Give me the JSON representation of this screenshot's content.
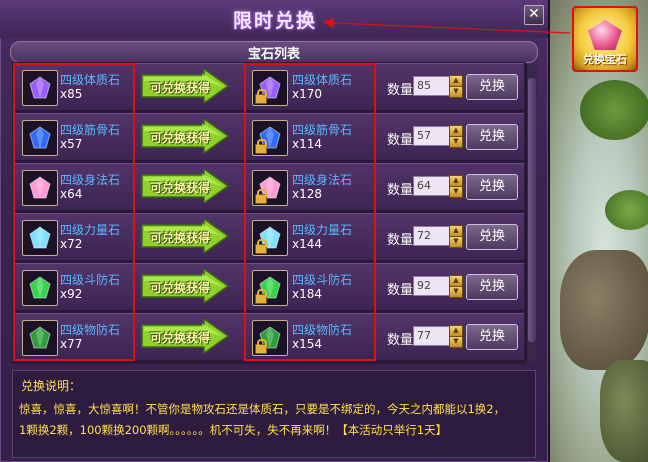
{
  "window": {
    "title": "限时兑换",
    "close_label": "✕",
    "list_header": "宝石列表"
  },
  "gem_shortcut": {
    "label": "兑换宝石"
  },
  "columns": {
    "arrow_label": "可兑换获得",
    "qty_label": "数量",
    "exchange_label": "兑换"
  },
  "rows": [
    {
      "source_name": "四级体质石",
      "source_qty": "x85",
      "target_name": "四级体质石",
      "target_qty": "x170",
      "input_value": "85",
      "gem_color": "#9b5cff"
    },
    {
      "source_name": "四级筋骨石",
      "source_qty": "x57",
      "target_name": "四级筋骨石",
      "target_qty": "x114",
      "input_value": "57",
      "gem_color": "#2f6bff"
    },
    {
      "source_name": "四级身法石",
      "source_qty": "x64",
      "target_name": "四级身法石",
      "target_qty": "x128",
      "input_value": "64",
      "gem_color": "#ff9ad5"
    },
    {
      "source_name": "四级力量石",
      "source_qty": "x72",
      "target_name": "四级力量石",
      "target_qty": "x144",
      "input_value": "72",
      "gem_color": "#7fe0ff"
    },
    {
      "source_name": "四级斗防石",
      "source_qty": "x92",
      "target_name": "四级斗防石",
      "target_qty": "x184",
      "input_value": "92",
      "gem_color": "#36d24a"
    },
    {
      "source_name": "四级物防石",
      "source_qty": "x77",
      "target_name": "四级物防石",
      "target_qty": "x154",
      "input_value": "77",
      "gem_color": "#2e9e3a"
    }
  ],
  "description": {
    "title": "兑换说明：",
    "line1": "惊喜，惊喜，大惊喜啊！不管你是物攻石还是体质石，只要是不绑定的，今天之内都能以1换2，",
    "line2": "1颗换2颗，100颗换200颗啊。。。。。。机不可失，失不再来啊！【本活动只举行1天】"
  }
}
